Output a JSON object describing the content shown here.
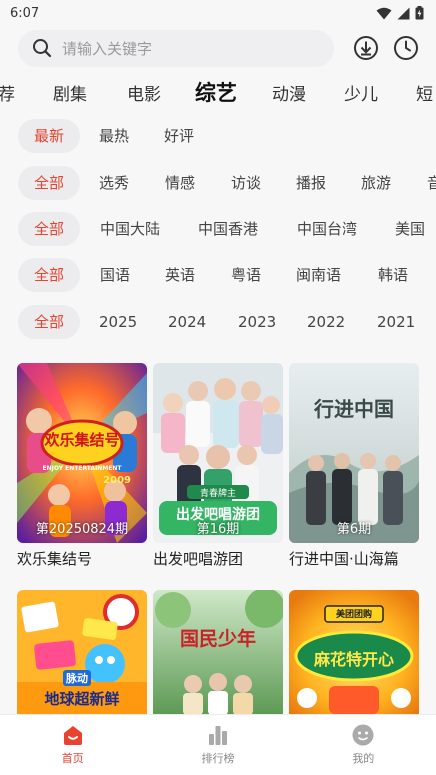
{
  "status": {
    "time": "6:07"
  },
  "search": {
    "placeholder": "请输入关键字"
  },
  "tabs": [
    "荐",
    "剧集",
    "电影",
    "综艺",
    "动漫",
    "少儿",
    "短"
  ],
  "filters": {
    "sort": [
      "最新",
      "最热",
      "好评"
    ],
    "genre": [
      "全部",
      "选秀",
      "情感",
      "访谈",
      "播报",
      "旅游",
      "音"
    ],
    "region": [
      "全部",
      "中国大陆",
      "中国香港",
      "中国台湾",
      "美国"
    ],
    "language": [
      "全部",
      "国语",
      "英语",
      "粤语",
      "闽南语",
      "韩语"
    ],
    "year": [
      "全部",
      "2025",
      "2024",
      "2023",
      "2022",
      "2021"
    ]
  },
  "cards": [
    {
      "title": "欢乐集结号",
      "episode": "第20250824期"
    },
    {
      "title": "出发吧唱游团",
      "episode": "第16期"
    },
    {
      "title": "行进中国·山海篇",
      "episode": "第6期"
    }
  ],
  "poster_text": {
    "p1_logo": "欢乐集结号",
    "p1_sub": "ENJOY ENTERTAINMENT",
    "p1_year": "2009",
    "p2_logo": "出发吧唱游团",
    "p2_badge": "青春牌主",
    "p3_logo": "行进中国",
    "p4_logo": "地球超新鲜",
    "p4_tag": "脉动",
    "p5_logo": "国民少年",
    "p6_logo": "麻花特开心",
    "p6_brand": "美团团购"
  },
  "nav": [
    "首页",
    "排行榜",
    "我的"
  ],
  "colors": {
    "accent": "#e8432e",
    "chip_bg": "#ececee"
  }
}
